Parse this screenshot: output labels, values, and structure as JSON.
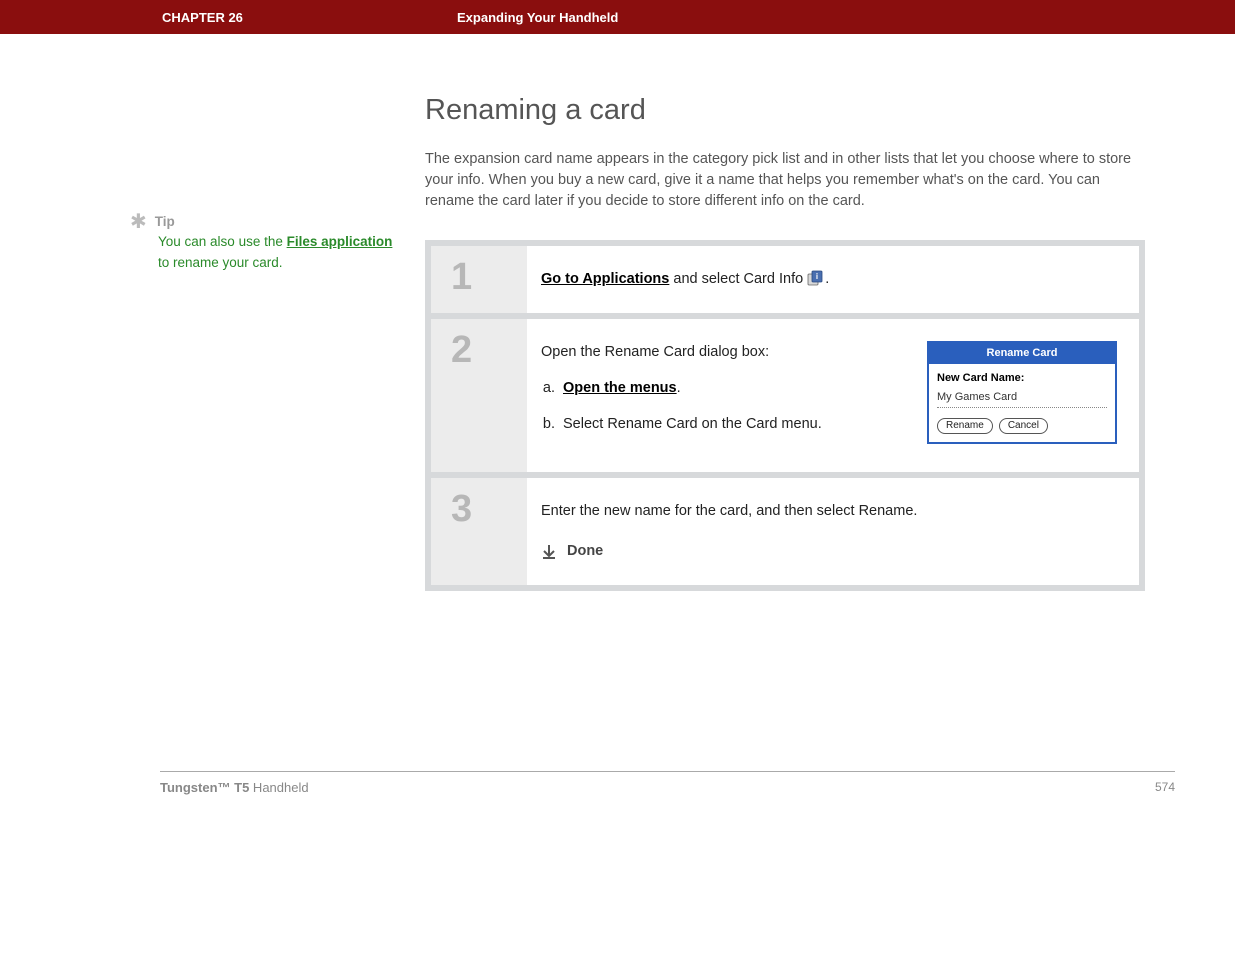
{
  "header": {
    "chapter": "CHAPTER 26",
    "title": "Expanding Your Handheld"
  },
  "main": {
    "heading": "Renaming a card",
    "intro": "The expansion card name appears in the category pick list and in other lists that let you choose where to store your info. When you buy a new card, give it a name that helps you remember what's on the card. You can rename the card later if you decide to store different info on the card."
  },
  "tip": {
    "label": "Tip",
    "text_before": "You can also use the ",
    "link": "Files application",
    "text_after": " to rename your card."
  },
  "steps": [
    {
      "num": "1",
      "link": "Go to Applications",
      "after_link": " and select Card Info ",
      "period": "."
    },
    {
      "num": "2",
      "lead": "Open the Rename Card dialog box:",
      "a_link": "Open the menus",
      "a_period": ".",
      "b": "Select Rename Card on the Card menu."
    },
    {
      "num": "3",
      "text": "Enter the new name for the card, and then select Rename.",
      "done": "Done"
    }
  ],
  "dialog": {
    "title": "Rename Card",
    "label": "New Card Name:",
    "value": "My Games Card",
    "btn1": "Rename",
    "btn2": "Cancel"
  },
  "footer": {
    "product_bold": "Tungsten™ T5",
    "product_rest": " Handheld",
    "page": "574"
  }
}
